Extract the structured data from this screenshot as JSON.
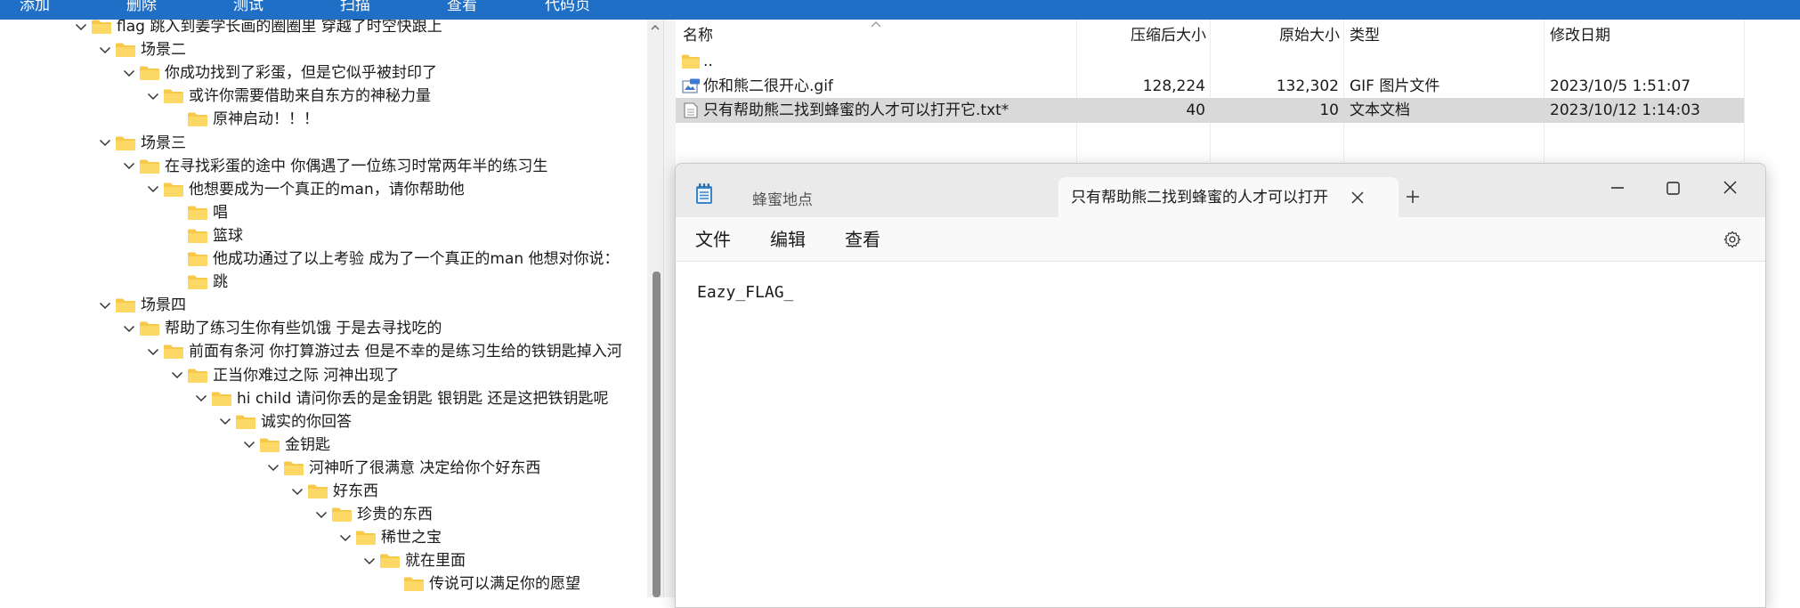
{
  "toolbar": {
    "items": [
      "添加",
      "删除",
      "测试",
      "扫描",
      "查看",
      "代码页"
    ]
  },
  "tree": {
    "rows": [
      {
        "label": "flag 跳入到姜学长画的圈圈里 穿越了时空快跟上",
        "expanded": true
      },
      {
        "label": "场景二",
        "expanded": true
      },
      {
        "label": "你成功找到了彩蛋，但是它似乎被封印了",
        "expanded": true
      },
      {
        "label": "或许你需要借助来自东方的神秘力量",
        "expanded": true
      },
      {
        "label": "原神启动！！！",
        "expanded": false
      },
      {
        "label": "场景三",
        "expanded": true
      },
      {
        "label": "在寻找彩蛋的途中 你偶遇了一位练习时常两年半的练习生",
        "expanded": true
      },
      {
        "label": "他想要成为一个真正的man，请你帮助他",
        "expanded": true
      },
      {
        "label": "唱",
        "expanded": false
      },
      {
        "label": "篮球",
        "expanded": false
      },
      {
        "label": "他成功通过了以上考验 成为了一个真正的man 他想对你说：",
        "expanded": false
      },
      {
        "label": "跳",
        "expanded": false
      },
      {
        "label": "场景四",
        "expanded": true
      },
      {
        "label": "帮助了练习生你有些饥饿 于是去寻找吃的",
        "expanded": true
      },
      {
        "label": "前面有条河 你打算游过去 但是不幸的是练习生给的铁钥匙掉入河",
        "expanded": true
      },
      {
        "label": "正当你难过之际 河神出现了",
        "expanded": true
      },
      {
        "label": "hi child  请问你丢的是金钥匙 银钥匙 还是这把铁钥匙呢",
        "expanded": true
      },
      {
        "label": "诚实的你回答",
        "expanded": true
      },
      {
        "label": "金钥匙",
        "expanded": true
      },
      {
        "label": "河神听了很满意 决定给你个好东西",
        "expanded": true
      },
      {
        "label": "好东西",
        "expanded": true
      },
      {
        "label": "珍贵的东西",
        "expanded": true
      },
      {
        "label": "稀世之宝",
        "expanded": true
      },
      {
        "label": "就在里面",
        "expanded": true
      },
      {
        "label": "传说可以满足你的愿望",
        "expanded": false
      }
    ]
  },
  "file_list": {
    "columns": [
      "名称",
      "压缩后大小",
      "原始大小",
      "类型",
      "修改日期"
    ],
    "rows": [
      {
        "name": "..",
        "packed": "",
        "size": "",
        "type": "",
        "modified": "",
        "icon": "folder-icon"
      },
      {
        "name": "你和熊二很开心.gif",
        "packed": "128,224",
        "size": "132,302",
        "type": "GIF 图片文件",
        "modified": "2023/10/5 1:51:07",
        "icon": "gif-file-icon"
      },
      {
        "name": "只有帮助熊二找到蜂蜜的人才可以打开它.txt*",
        "packed": "40",
        "size": "10",
        "type": "文本文档",
        "modified": "2023/10/12 1:14:03",
        "icon": "text-file-icon",
        "selected": true
      }
    ]
  },
  "notepad": {
    "tab_inactive": "蜂蜜地点",
    "tab_active": "只有帮助熊二找到蜂蜜的人才可以打开它.txt",
    "menu": [
      "文件",
      "编辑",
      "查看"
    ],
    "content": "Eazy_FLAG_"
  },
  "colors": {
    "toolbar_bg": "#1f6fc7",
    "folder_yellow": "#f8c948",
    "selection": "#d9d9d9"
  }
}
